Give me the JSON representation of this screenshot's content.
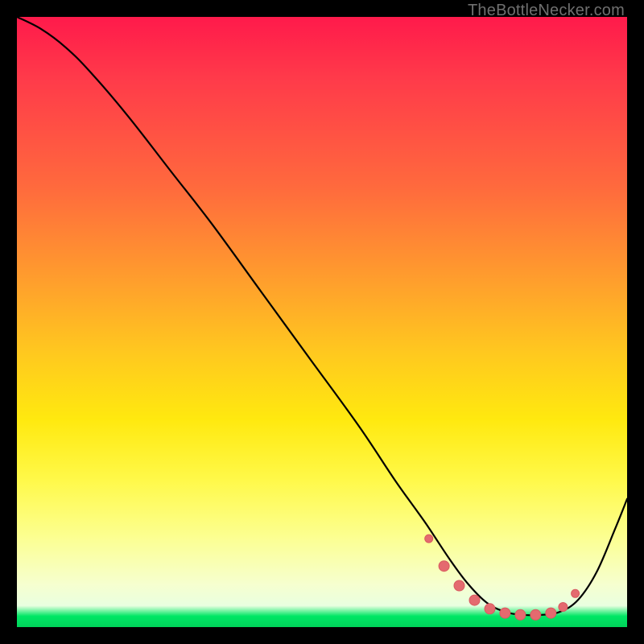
{
  "watermark": "TheBottleNecker.com",
  "colors": {
    "curve": "#000000",
    "marker": "#e46a6f",
    "marker_stroke": "#d85a60"
  },
  "chart_data": {
    "type": "line",
    "title": "",
    "xlabel": "",
    "ylabel": "",
    "xlim": [
      0,
      100
    ],
    "ylim": [
      0,
      100
    ],
    "series": [
      {
        "name": "curve",
        "x": [
          0,
          4,
          8,
          12,
          18,
          25,
          32,
          40,
          48,
          56,
          62,
          67,
          71,
          74,
          77,
          80,
          83,
          86,
          89,
          92,
          95,
          98,
          100
        ],
        "y": [
          100,
          98,
          95,
          91,
          84,
          75,
          66,
          55,
          44,
          33,
          24,
          17,
          11,
          7,
          4,
          2.5,
          2,
          2,
          2.5,
          4.5,
          9,
          16,
          21
        ]
      }
    ],
    "markers": {
      "name": "flat-region",
      "x": [
        67.5,
        70,
        72.5,
        75,
        77.5,
        80,
        82.5,
        85,
        87.5,
        89.5,
        91.5
      ],
      "y": [
        14.5,
        10,
        6.8,
        4.4,
        3.0,
        2.3,
        2.0,
        2.0,
        2.3,
        3.3,
        5.5
      ],
      "r": [
        5,
        6.5,
        6.5,
        6.5,
        6.5,
        6.5,
        6.5,
        6.5,
        6.5,
        5.5,
        5
      ]
    }
  }
}
